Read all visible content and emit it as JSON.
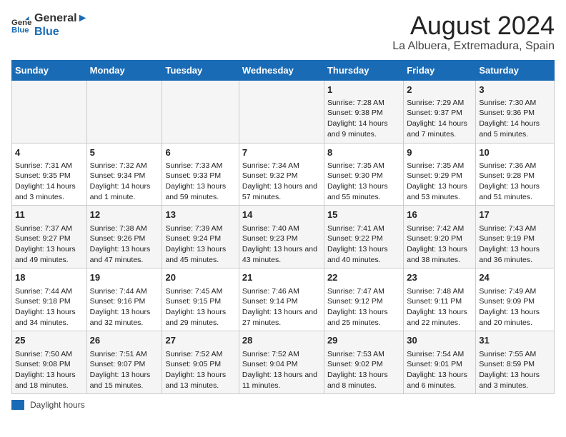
{
  "logo": {
    "line1": "General",
    "line2": "Blue"
  },
  "title": "August 2024",
  "subtitle": "La Albuera, Extremadura, Spain",
  "columns": [
    "Sunday",
    "Monday",
    "Tuesday",
    "Wednesday",
    "Thursday",
    "Friday",
    "Saturday"
  ],
  "legend_label": "Daylight hours",
  "rows": [
    [
      {
        "day": "",
        "info": ""
      },
      {
        "day": "",
        "info": ""
      },
      {
        "day": "",
        "info": ""
      },
      {
        "day": "",
        "info": ""
      },
      {
        "day": "1",
        "info": "Sunrise: 7:28 AM\nSunset: 9:38 PM\nDaylight: 14 hours and 9 minutes."
      },
      {
        "day": "2",
        "info": "Sunrise: 7:29 AM\nSunset: 9:37 PM\nDaylight: 14 hours and 7 minutes."
      },
      {
        "day": "3",
        "info": "Sunrise: 7:30 AM\nSunset: 9:36 PM\nDaylight: 14 hours and 5 minutes."
      }
    ],
    [
      {
        "day": "4",
        "info": "Sunrise: 7:31 AM\nSunset: 9:35 PM\nDaylight: 14 hours and 3 minutes."
      },
      {
        "day": "5",
        "info": "Sunrise: 7:32 AM\nSunset: 9:34 PM\nDaylight: 14 hours and 1 minute."
      },
      {
        "day": "6",
        "info": "Sunrise: 7:33 AM\nSunset: 9:33 PM\nDaylight: 13 hours and 59 minutes."
      },
      {
        "day": "7",
        "info": "Sunrise: 7:34 AM\nSunset: 9:32 PM\nDaylight: 13 hours and 57 minutes."
      },
      {
        "day": "8",
        "info": "Sunrise: 7:35 AM\nSunset: 9:30 PM\nDaylight: 13 hours and 55 minutes."
      },
      {
        "day": "9",
        "info": "Sunrise: 7:35 AM\nSunset: 9:29 PM\nDaylight: 13 hours and 53 minutes."
      },
      {
        "day": "10",
        "info": "Sunrise: 7:36 AM\nSunset: 9:28 PM\nDaylight: 13 hours and 51 minutes."
      }
    ],
    [
      {
        "day": "11",
        "info": "Sunrise: 7:37 AM\nSunset: 9:27 PM\nDaylight: 13 hours and 49 minutes."
      },
      {
        "day": "12",
        "info": "Sunrise: 7:38 AM\nSunset: 9:26 PM\nDaylight: 13 hours and 47 minutes."
      },
      {
        "day": "13",
        "info": "Sunrise: 7:39 AM\nSunset: 9:24 PM\nDaylight: 13 hours and 45 minutes."
      },
      {
        "day": "14",
        "info": "Sunrise: 7:40 AM\nSunset: 9:23 PM\nDaylight: 13 hours and 43 minutes."
      },
      {
        "day": "15",
        "info": "Sunrise: 7:41 AM\nSunset: 9:22 PM\nDaylight: 13 hours and 40 minutes."
      },
      {
        "day": "16",
        "info": "Sunrise: 7:42 AM\nSunset: 9:20 PM\nDaylight: 13 hours and 38 minutes."
      },
      {
        "day": "17",
        "info": "Sunrise: 7:43 AM\nSunset: 9:19 PM\nDaylight: 13 hours and 36 minutes."
      }
    ],
    [
      {
        "day": "18",
        "info": "Sunrise: 7:44 AM\nSunset: 9:18 PM\nDaylight: 13 hours and 34 minutes."
      },
      {
        "day": "19",
        "info": "Sunrise: 7:44 AM\nSunset: 9:16 PM\nDaylight: 13 hours and 32 minutes."
      },
      {
        "day": "20",
        "info": "Sunrise: 7:45 AM\nSunset: 9:15 PM\nDaylight: 13 hours and 29 minutes."
      },
      {
        "day": "21",
        "info": "Sunrise: 7:46 AM\nSunset: 9:14 PM\nDaylight: 13 hours and 27 minutes."
      },
      {
        "day": "22",
        "info": "Sunrise: 7:47 AM\nSunset: 9:12 PM\nDaylight: 13 hours and 25 minutes."
      },
      {
        "day": "23",
        "info": "Sunrise: 7:48 AM\nSunset: 9:11 PM\nDaylight: 13 hours and 22 minutes."
      },
      {
        "day": "24",
        "info": "Sunrise: 7:49 AM\nSunset: 9:09 PM\nDaylight: 13 hours and 20 minutes."
      }
    ],
    [
      {
        "day": "25",
        "info": "Sunrise: 7:50 AM\nSunset: 9:08 PM\nDaylight: 13 hours and 18 minutes."
      },
      {
        "day": "26",
        "info": "Sunrise: 7:51 AM\nSunset: 9:07 PM\nDaylight: 13 hours and 15 minutes."
      },
      {
        "day": "27",
        "info": "Sunrise: 7:52 AM\nSunset: 9:05 PM\nDaylight: 13 hours and 13 minutes."
      },
      {
        "day": "28",
        "info": "Sunrise: 7:52 AM\nSunset: 9:04 PM\nDaylight: 13 hours and 11 minutes."
      },
      {
        "day": "29",
        "info": "Sunrise: 7:53 AM\nSunset: 9:02 PM\nDaylight: 13 hours and 8 minutes."
      },
      {
        "day": "30",
        "info": "Sunrise: 7:54 AM\nSunset: 9:01 PM\nDaylight: 13 hours and 6 minutes."
      },
      {
        "day": "31",
        "info": "Sunrise: 7:55 AM\nSunset: 8:59 PM\nDaylight: 13 hours and 3 minutes."
      }
    ]
  ]
}
